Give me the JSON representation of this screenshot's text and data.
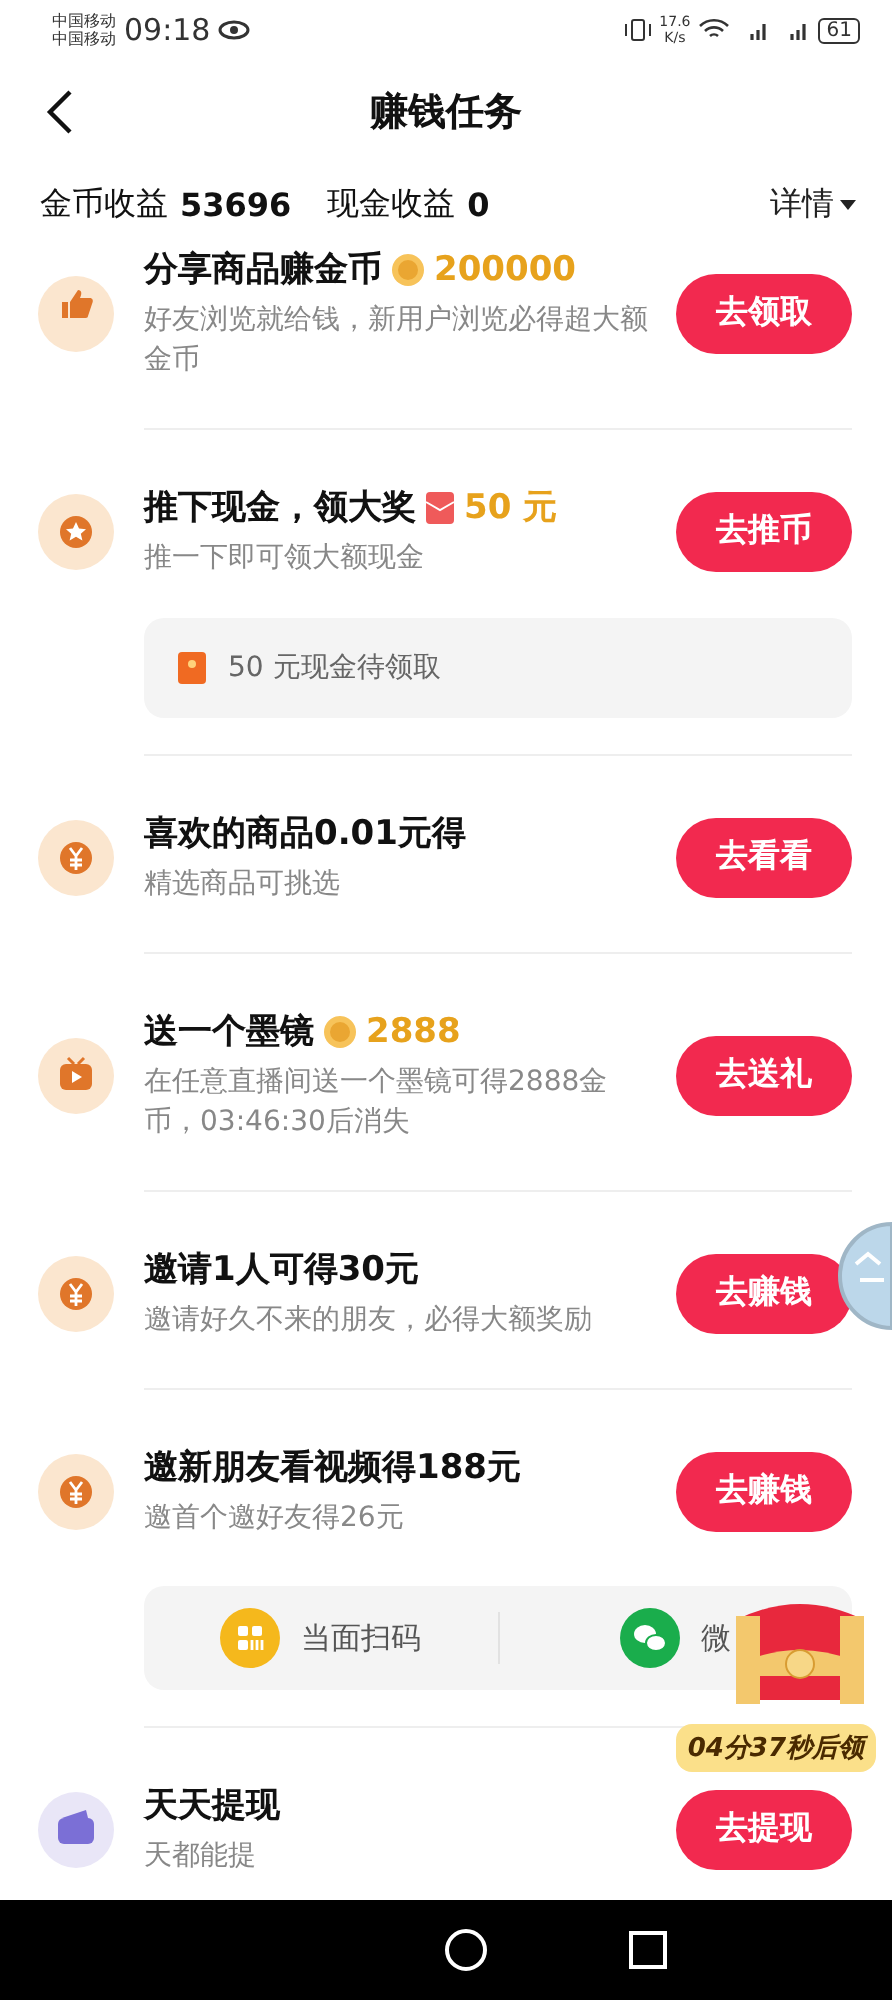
{
  "status_bar": {
    "carriers": [
      "中国移动",
      "中国移动"
    ],
    "time": "09:18",
    "net_speed": [
      "17.6",
      "K/s"
    ],
    "battery": "61"
  },
  "header": {
    "title": "赚钱任务"
  },
  "earnings": {
    "coin_label": "金币收益",
    "coin_value": "53696",
    "cash_label": "现金收益",
    "cash_value": "0",
    "details": "详情"
  },
  "tasks": [
    {
      "title": "分享商品赚金币",
      "reward": {
        "kind": "coin",
        "amount": "200000"
      },
      "subtitle": "好友浏览就给钱，新用户浏览必得超大额金币",
      "button": "去领取"
    },
    {
      "title": "推下现金，领大奖",
      "reward": {
        "kind": "redpacket",
        "amount": "50 元"
      },
      "subtitle": "推一下即可领大额现金",
      "button": "去推币",
      "extra": {
        "kind": "pending",
        "text": "50 元现金待领取"
      }
    },
    {
      "title": "喜欢的商品0.01元得",
      "subtitle": "精选商品可挑选",
      "button": "去看看"
    },
    {
      "title": "送一个墨镜",
      "reward": {
        "kind": "coin",
        "amount": "2888"
      },
      "subtitle": "在任意直播间送一个墨镜可得2888金币，03:46:30后消失",
      "button": "去送礼"
    },
    {
      "title": "邀请1人可得30元",
      "subtitle": "邀请好久不来的朋友，必得大额奖励",
      "button": "去赚钱"
    },
    {
      "title": "邀新朋友看视频得188元",
      "subtitle": "邀首个邀好友得26元",
      "button": "去赚钱",
      "extra": {
        "kind": "share",
        "options": [
          {
            "label": "当面扫码"
          },
          {
            "label": "微"
          }
        ]
      }
    },
    {
      "title": "天天提现",
      "subtitle": "天都能提",
      "button": "去提现"
    }
  ],
  "floating": {
    "chest_timer": "04分37秒后领"
  }
}
